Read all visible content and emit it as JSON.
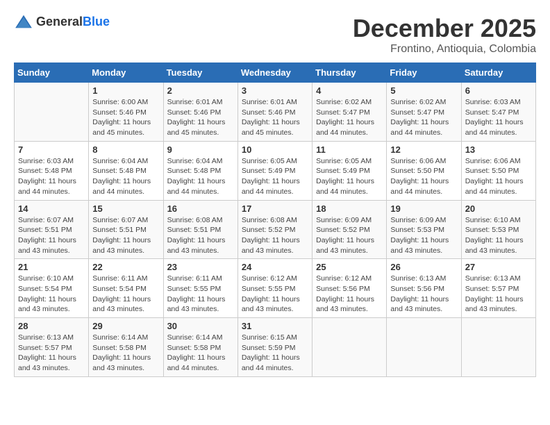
{
  "header": {
    "logo_general": "General",
    "logo_blue": "Blue",
    "month": "December 2025",
    "location": "Frontino, Antioquia, Colombia"
  },
  "days_of_week": [
    "Sunday",
    "Monday",
    "Tuesday",
    "Wednesday",
    "Thursday",
    "Friday",
    "Saturday"
  ],
  "weeks": [
    [
      {
        "day": "",
        "sunrise": "",
        "sunset": "",
        "daylight": ""
      },
      {
        "day": "1",
        "sunrise": "Sunrise: 6:00 AM",
        "sunset": "Sunset: 5:46 PM",
        "daylight": "Daylight: 11 hours and 45 minutes."
      },
      {
        "day": "2",
        "sunrise": "Sunrise: 6:01 AM",
        "sunset": "Sunset: 5:46 PM",
        "daylight": "Daylight: 11 hours and 45 minutes."
      },
      {
        "day": "3",
        "sunrise": "Sunrise: 6:01 AM",
        "sunset": "Sunset: 5:46 PM",
        "daylight": "Daylight: 11 hours and 45 minutes."
      },
      {
        "day": "4",
        "sunrise": "Sunrise: 6:02 AM",
        "sunset": "Sunset: 5:47 PM",
        "daylight": "Daylight: 11 hours and 44 minutes."
      },
      {
        "day": "5",
        "sunrise": "Sunrise: 6:02 AM",
        "sunset": "Sunset: 5:47 PM",
        "daylight": "Daylight: 11 hours and 44 minutes."
      },
      {
        "day": "6",
        "sunrise": "Sunrise: 6:03 AM",
        "sunset": "Sunset: 5:47 PM",
        "daylight": "Daylight: 11 hours and 44 minutes."
      }
    ],
    [
      {
        "day": "7",
        "sunrise": "Sunrise: 6:03 AM",
        "sunset": "Sunset: 5:48 PM",
        "daylight": "Daylight: 11 hours and 44 minutes."
      },
      {
        "day": "8",
        "sunrise": "Sunrise: 6:04 AM",
        "sunset": "Sunset: 5:48 PM",
        "daylight": "Daylight: 11 hours and 44 minutes."
      },
      {
        "day": "9",
        "sunrise": "Sunrise: 6:04 AM",
        "sunset": "Sunset: 5:48 PM",
        "daylight": "Daylight: 11 hours and 44 minutes."
      },
      {
        "day": "10",
        "sunrise": "Sunrise: 6:05 AM",
        "sunset": "Sunset: 5:49 PM",
        "daylight": "Daylight: 11 hours and 44 minutes."
      },
      {
        "day": "11",
        "sunrise": "Sunrise: 6:05 AM",
        "sunset": "Sunset: 5:49 PM",
        "daylight": "Daylight: 11 hours and 44 minutes."
      },
      {
        "day": "12",
        "sunrise": "Sunrise: 6:06 AM",
        "sunset": "Sunset: 5:50 PM",
        "daylight": "Daylight: 11 hours and 44 minutes."
      },
      {
        "day": "13",
        "sunrise": "Sunrise: 6:06 AM",
        "sunset": "Sunset: 5:50 PM",
        "daylight": "Daylight: 11 hours and 44 minutes."
      }
    ],
    [
      {
        "day": "14",
        "sunrise": "Sunrise: 6:07 AM",
        "sunset": "Sunset: 5:51 PM",
        "daylight": "Daylight: 11 hours and 43 minutes."
      },
      {
        "day": "15",
        "sunrise": "Sunrise: 6:07 AM",
        "sunset": "Sunset: 5:51 PM",
        "daylight": "Daylight: 11 hours and 43 minutes."
      },
      {
        "day": "16",
        "sunrise": "Sunrise: 6:08 AM",
        "sunset": "Sunset: 5:51 PM",
        "daylight": "Daylight: 11 hours and 43 minutes."
      },
      {
        "day": "17",
        "sunrise": "Sunrise: 6:08 AM",
        "sunset": "Sunset: 5:52 PM",
        "daylight": "Daylight: 11 hours and 43 minutes."
      },
      {
        "day": "18",
        "sunrise": "Sunrise: 6:09 AM",
        "sunset": "Sunset: 5:52 PM",
        "daylight": "Daylight: 11 hours and 43 minutes."
      },
      {
        "day": "19",
        "sunrise": "Sunrise: 6:09 AM",
        "sunset": "Sunset: 5:53 PM",
        "daylight": "Daylight: 11 hours and 43 minutes."
      },
      {
        "day": "20",
        "sunrise": "Sunrise: 6:10 AM",
        "sunset": "Sunset: 5:53 PM",
        "daylight": "Daylight: 11 hours and 43 minutes."
      }
    ],
    [
      {
        "day": "21",
        "sunrise": "Sunrise: 6:10 AM",
        "sunset": "Sunset: 5:54 PM",
        "daylight": "Daylight: 11 hours and 43 minutes."
      },
      {
        "day": "22",
        "sunrise": "Sunrise: 6:11 AM",
        "sunset": "Sunset: 5:54 PM",
        "daylight": "Daylight: 11 hours and 43 minutes."
      },
      {
        "day": "23",
        "sunrise": "Sunrise: 6:11 AM",
        "sunset": "Sunset: 5:55 PM",
        "daylight": "Daylight: 11 hours and 43 minutes."
      },
      {
        "day": "24",
        "sunrise": "Sunrise: 6:12 AM",
        "sunset": "Sunset: 5:55 PM",
        "daylight": "Daylight: 11 hours and 43 minutes."
      },
      {
        "day": "25",
        "sunrise": "Sunrise: 6:12 AM",
        "sunset": "Sunset: 5:56 PM",
        "daylight": "Daylight: 11 hours and 43 minutes."
      },
      {
        "day": "26",
        "sunrise": "Sunrise: 6:13 AM",
        "sunset": "Sunset: 5:56 PM",
        "daylight": "Daylight: 11 hours and 43 minutes."
      },
      {
        "day": "27",
        "sunrise": "Sunrise: 6:13 AM",
        "sunset": "Sunset: 5:57 PM",
        "daylight": "Daylight: 11 hours and 43 minutes."
      }
    ],
    [
      {
        "day": "28",
        "sunrise": "Sunrise: 6:13 AM",
        "sunset": "Sunset: 5:57 PM",
        "daylight": "Daylight: 11 hours and 43 minutes."
      },
      {
        "day": "29",
        "sunrise": "Sunrise: 6:14 AM",
        "sunset": "Sunset: 5:58 PM",
        "daylight": "Daylight: 11 hours and 43 minutes."
      },
      {
        "day": "30",
        "sunrise": "Sunrise: 6:14 AM",
        "sunset": "Sunset: 5:58 PM",
        "daylight": "Daylight: 11 hours and 44 minutes."
      },
      {
        "day": "31",
        "sunrise": "Sunrise: 6:15 AM",
        "sunset": "Sunset: 5:59 PM",
        "daylight": "Daylight: 11 hours and 44 minutes."
      },
      {
        "day": "",
        "sunrise": "",
        "sunset": "",
        "daylight": ""
      },
      {
        "day": "",
        "sunrise": "",
        "sunset": "",
        "daylight": ""
      },
      {
        "day": "",
        "sunrise": "",
        "sunset": "",
        "daylight": ""
      }
    ]
  ]
}
